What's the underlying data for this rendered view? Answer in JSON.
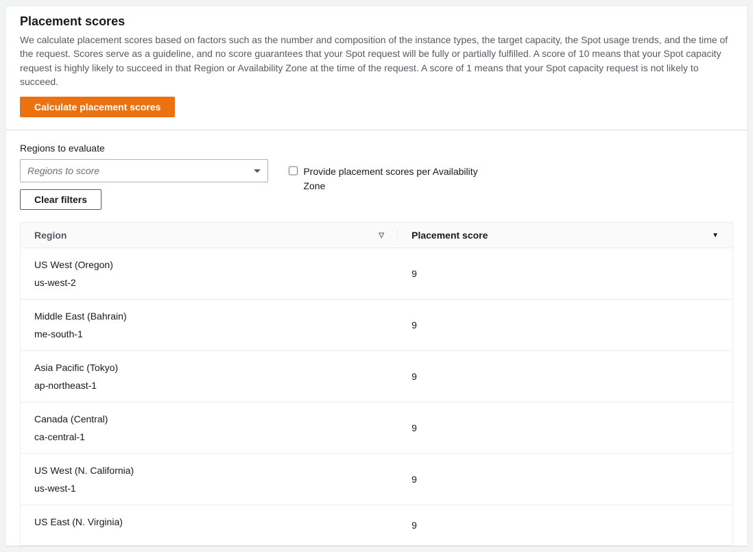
{
  "header": {
    "title": "Placement scores",
    "description": "We calculate placement scores based on factors such as the number and composition of the instance types, the target capacity, the Spot usage trends, and the time of the request. Scores serve as a guideline, and no score guarantees that your Spot request will be fully or partially fulfilled. A score of 10 means that your Spot capacity request is highly likely to succeed in that Region or Availability Zone at the time of the request. A score of 1 means that your Spot capacity request is not likely to succeed.",
    "calculate_button": "Calculate placement scores"
  },
  "filters": {
    "regions_label": "Regions to evaluate",
    "regions_placeholder": "Regions to score",
    "clear_button": "Clear filters",
    "az_checkbox_label": "Provide placement scores per Availability Zone"
  },
  "table": {
    "columns": {
      "region": "Region",
      "score": "Placement score"
    },
    "rows": [
      {
        "name": "US West (Oregon)",
        "code": "us-west-2",
        "score": "9"
      },
      {
        "name": "Middle East (Bahrain)",
        "code": "me-south-1",
        "score": "9"
      },
      {
        "name": "Asia Pacific (Tokyo)",
        "code": "ap-northeast-1",
        "score": "9"
      },
      {
        "name": "Canada (Central)",
        "code": "ca-central-1",
        "score": "9"
      },
      {
        "name": "US West (N. California)",
        "code": "us-west-1",
        "score": "9"
      },
      {
        "name": "US East (N. Virginia)",
        "code": "",
        "score": "9"
      }
    ]
  }
}
